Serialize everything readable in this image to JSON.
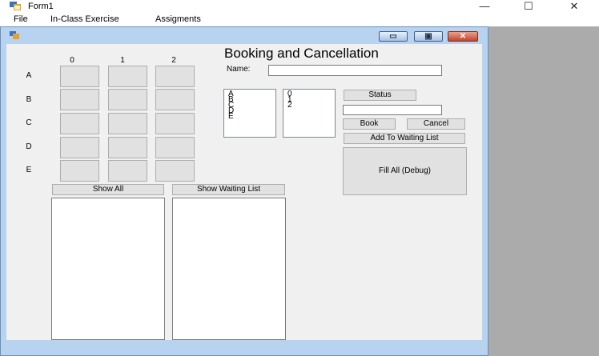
{
  "window": {
    "title": "Form1",
    "minimize_glyph": "—",
    "maximize_glyph": "☐",
    "close_glyph": "✕",
    "icon": "form-icon"
  },
  "menu": [
    "File",
    "In-Class Exercise",
    "Assigments"
  ],
  "child_window": {
    "icon": "form-icon",
    "minimize_glyph": "▭",
    "maximize_glyph": "▣",
    "close_glyph": "✕"
  },
  "form": {
    "heading": "Booking and Cancellation",
    "name_label": "Name:",
    "name_value": "",
    "column_headers": [
      "0",
      "1",
      "2"
    ],
    "row_headers": [
      "A",
      "B",
      "C",
      "D",
      "E"
    ],
    "row_list": [
      "A",
      "B",
      "C",
      "D",
      "E"
    ],
    "col_list": [
      "0",
      "1",
      "2"
    ],
    "status_button": "Status",
    "status_value": "",
    "book_button": "Book",
    "cancel_button": "Cancel",
    "waiting_button": "Add To Waiting List",
    "fill_button": "Fill All (Debug)",
    "show_all_button": "Show All",
    "show_waiting_button": "Show Waiting List"
  },
  "colors": {
    "child_frame": "#b8d3f0",
    "close_button": "#c2452c",
    "form_background": "#f0f0f0",
    "seat_background": "#e1e1e1"
  }
}
